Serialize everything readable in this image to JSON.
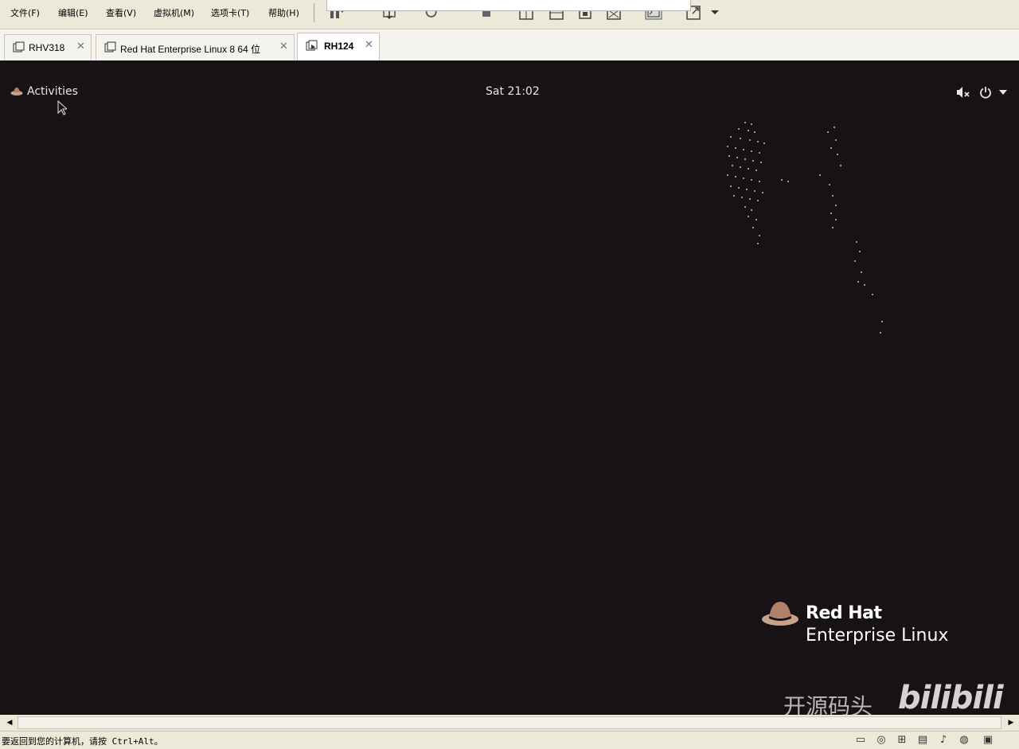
{
  "menubar": {
    "items": [
      "文件(F)",
      "编辑(E)",
      "查看(V)",
      "虚拟机(M)",
      "选项卡(T)",
      "帮助(H)"
    ]
  },
  "tabs": [
    {
      "label": "RHV318",
      "active": false
    },
    {
      "label": "Red Hat Enterprise Linux 8 64 位",
      "active": false
    },
    {
      "label": "RH124",
      "active": true
    }
  ],
  "guest": {
    "activities": "Activities",
    "clock": "Sat 21:02",
    "logo_line1": "Red Hat",
    "logo_line2": "Enterprise Linux"
  },
  "watermark": {
    "text": "开源码头",
    "brand": "bilibili"
  },
  "status": {
    "text": "要返回到您的计算机，请按 Ctrl+Alt。"
  },
  "colors": {
    "host_chrome": "#ece9d8",
    "guest_background": "#161216",
    "guest_text": "#e8e6e3"
  }
}
